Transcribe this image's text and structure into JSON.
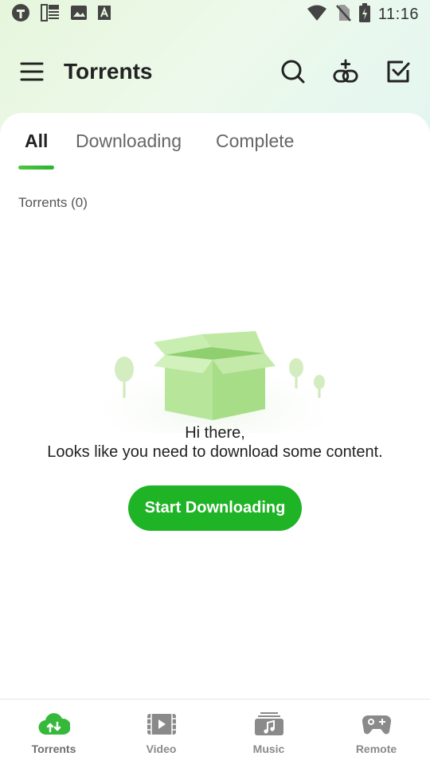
{
  "status_bar": {
    "time": "11:16",
    "icons": [
      "app-logo-icon",
      "news-icon",
      "image-icon",
      "font-icon",
      "wifi-icon",
      "no-sim-icon",
      "battery-icon"
    ]
  },
  "app_bar": {
    "title": "Torrents",
    "icons": [
      "menu-icon",
      "search-icon",
      "add-link-icon",
      "select-icon"
    ]
  },
  "tabs": [
    {
      "label": "All",
      "active": true
    },
    {
      "label": "Downloading",
      "active": false
    },
    {
      "label": "Complete",
      "active": false
    }
  ],
  "list": {
    "count_label": "Torrents (0)"
  },
  "empty_state": {
    "line1": "Hi there,",
    "line2": "Looks like you need to download some content.",
    "button_label": "Start Downloading",
    "illustration": "open-box-illustration"
  },
  "bottom_nav": {
    "items": [
      {
        "label": "Torrents",
        "icon": "cloud-transfer-icon",
        "active": true
      },
      {
        "label": "Video",
        "icon": "film-icon",
        "active": false
      },
      {
        "label": "Music",
        "icon": "music-icon",
        "active": false
      },
      {
        "label": "Remote",
        "icon": "gamepad-icon",
        "active": false
      }
    ]
  },
  "colors": {
    "accent": "#1fb326",
    "header_gradient_start": "#e6f6dc",
    "header_gradient_end": "#e3f6f2",
    "inactive": "#8a8a8a"
  }
}
